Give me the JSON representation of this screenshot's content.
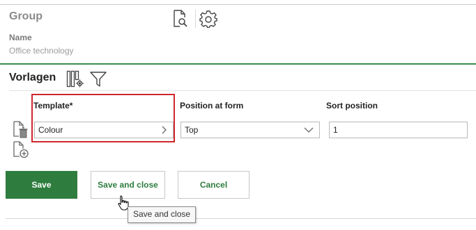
{
  "header": {
    "title": "Group",
    "preview_icon": "document-search-icon",
    "settings_icon": "gear-icon"
  },
  "name_field": {
    "label": "Name",
    "value": "Office technology"
  },
  "section": {
    "title": "Vorlagen",
    "columns_icon": "column-settings-icon",
    "filter_icon": "filter-icon"
  },
  "table": {
    "columns": [
      "Template*",
      "Position at form",
      "Sort position"
    ],
    "row": {
      "template": "Colour",
      "position": "Top",
      "sort": "1"
    },
    "delete_icon": "delete-document-icon",
    "add_icon": "add-document-icon"
  },
  "buttons": {
    "save": "Save",
    "save_close": "Save and close",
    "cancel": "Cancel"
  },
  "tooltip": "Save and close",
  "colors": {
    "accent": "#2e7d3f",
    "highlight": "#d0262d"
  }
}
